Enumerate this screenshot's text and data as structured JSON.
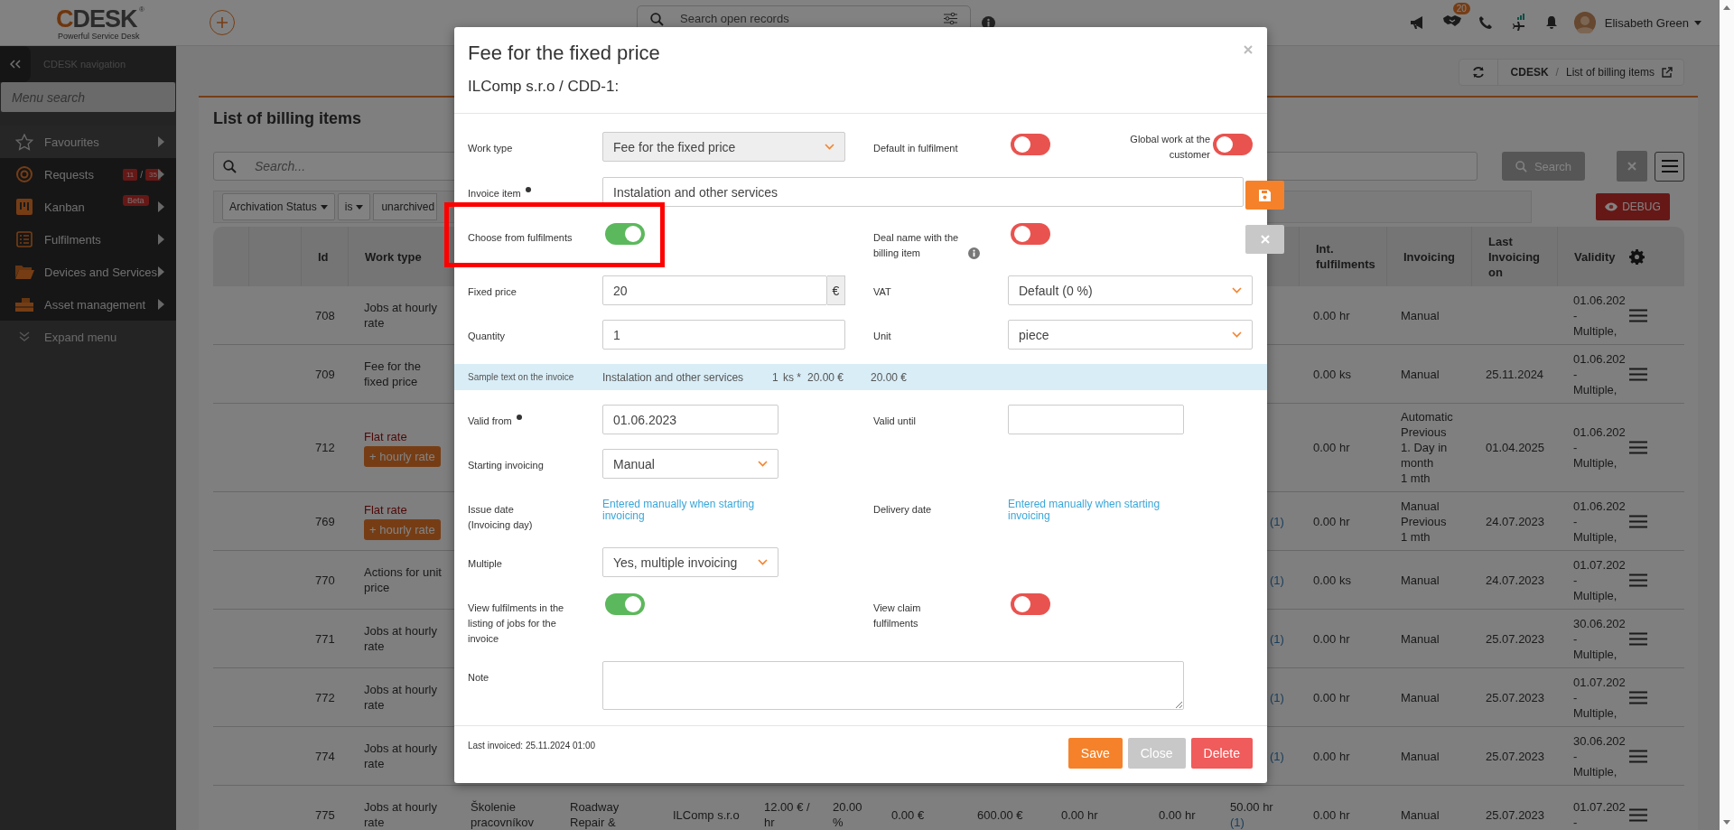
{
  "topbar": {
    "logo": "CDESK",
    "logo_mark": "®",
    "tagline": "Powerful Service Desk",
    "search": {
      "placeholder": "Search open records"
    },
    "handshake_count": "20",
    "user": "Elisabeth Green"
  },
  "sidebar": {
    "title": "CDESK navigation",
    "search": {
      "placeholder": "Menu search"
    },
    "items": [
      {
        "label": "Favourites",
        "selected": true
      },
      {
        "label": "Requests",
        "counts": [
          "11",
          "35"
        ],
        "count_separator": "/",
        "selected": false
      },
      {
        "label": "Kanban",
        "tag": "Beta",
        "selected": false
      },
      {
        "label": "Fulfilments",
        "selected": false
      },
      {
        "label": "Devices and Services",
        "selected": false
      },
      {
        "label": "Asset management",
        "selected": false
      }
    ],
    "expand": "Expand menu"
  },
  "breadcrumb": {
    "items": [
      "CDESK",
      "List of billing items"
    ],
    "separator": "/"
  },
  "page": {
    "title": "List of billing items",
    "search": {
      "placeholder": "Search..."
    },
    "search_button": "Search",
    "debug_button": "DEBUG",
    "filters": [
      {
        "label": "Archivation Status",
        "kind": "dropdown"
      },
      {
        "label": "is",
        "kind": "dropdown"
      },
      {
        "label": "unarchived",
        "kind": "value"
      }
    ]
  },
  "table": {
    "columns": [
      "Id",
      "Work type",
      "Int. fulfilments",
      "Invoicing",
      "Last Invoicing on",
      "Validity"
    ],
    "rows": [
      {
        "id": "708",
        "kind": "plain",
        "work_type": "Jobs at hourly rate",
        "int_fulfilments": "0.00 hr",
        "invoicing": "Manual",
        "validity": "01.06.202\n-\nMultiple,"
      },
      {
        "id": "709",
        "kind": "plain",
        "work_type": "Fee for the fixed price",
        "int_fulfilments": "0.00 ks",
        "invoicing": "Manual",
        "last_invoicing_on": "25.11.2024",
        "validity": "01.06.202\n-\nMultiple,"
      },
      {
        "id": "712",
        "kind": "flat",
        "work_type": "Flat rate",
        "badge": "+ hourly rate",
        "int_fulfilments": "0.00 hr",
        "invoicing": "Automatic\nPrevious\n1. Day in\nmonth\n1 mth",
        "last_invoicing_on": "01.04.2025",
        "validity": "01.06.202\n-\nMultiple,"
      },
      {
        "id": "769",
        "kind": "flat",
        "work_type": "Flat rate",
        "badge": "+ hourly rate",
        "fulfilment_count": "(1)",
        "int_fulfilments": "0.00 hr",
        "invoicing": "Manual\nPrevious\n1 mth",
        "last_invoicing_on": "24.07.2023",
        "validity": "01.06.202\n-\nMultiple,"
      },
      {
        "id": "770",
        "kind": "plain",
        "work_type": "Actions for unit price",
        "fulfilment_count": "(1)",
        "int_fulfilments": "0.00 ks",
        "invoicing": "Manual",
        "last_invoicing_on": "24.07.2023",
        "validity": "01.07.202\n-\nMultiple,"
      },
      {
        "id": "771",
        "kind": "plain",
        "work_type": "Jobs at hourly rate",
        "fulfilment_count": "(1)",
        "int_fulfilments": "0.00 hr",
        "invoicing": "Manual",
        "last_invoicing_on": "25.07.2023",
        "validity": "30.06.202\n-\nMultiple,"
      },
      {
        "id": "772",
        "kind": "plain",
        "work_type": "Jobs at hourly rate",
        "fulfilment_count": "(1)",
        "int_fulfilments": "0.00 hr",
        "invoicing": "Manual",
        "last_invoicing_on": "25.07.2023",
        "validity": "01.07.202\n-\nMultiple,"
      },
      {
        "id": "774",
        "kind": "plain",
        "work_type": "Jobs at hourly rate",
        "fulfilment_count": "(1)",
        "int_fulfilments": "0.00 hr",
        "invoicing": "Manual",
        "last_invoicing_on": "25.07.2023",
        "validity": "30.06.202\n-\nMultiple,"
      },
      {
        "id": "775",
        "kind": "plain",
        "work_type": "Jobs at hourly rate",
        "column_5": "Školenie pracovníkov",
        "column_6": "Roadway Repair &",
        "column_7": "ILComp s.r.o",
        "column_8": "12.00 € / hr",
        "column_9": "20.00 %",
        "column_10": "0.00 €",
        "column_11": "600.00 €",
        "column_12": "0.00 hr",
        "column_13": "0.00 hr",
        "column_14": "50.00 hr",
        "fulfilment_count": "(1)",
        "int_fulfilments": "0.00 hr",
        "invoicing": "Manual",
        "last_invoicing_on": "25.07.2023",
        "validity": "01.07.202\n-"
      }
    ]
  },
  "modal": {
    "title": "Fee for the fixed price",
    "subtitle": "ILComp s.r.o / CDD-1:",
    "rows": [
      {
        "left": {
          "label": "Work type",
          "kind": "select",
          "value": "Fee for the fixed price",
          "disabled": true
        },
        "right": [
          {
            "label": "Default in fulfilment",
            "kind": "toggle",
            "on": false
          },
          {
            "label": "Global work at the customer",
            "kind": "toggle",
            "on": false
          }
        ]
      },
      {
        "left": {
          "label": "Invoice item",
          "required": true,
          "kind": "wide_input",
          "value": "Instalation and other services"
        }
      },
      {
        "left": {
          "label": "Choose from fulfilments",
          "kind": "toggle",
          "on": true
        },
        "right": [
          {
            "label": "Deal name with the billing item",
            "kind": "toggle",
            "on": false,
            "info": true
          }
        ]
      },
      {
        "left": {
          "label": "Fixed price",
          "kind": "money",
          "value": "20",
          "unit": "€"
        },
        "right": [
          {
            "label": "VAT",
            "kind": "select",
            "value": "Default (0 %)"
          }
        ]
      },
      {
        "left": {
          "label": "Quantity",
          "kind": "input",
          "value": "1"
        },
        "right": [
          {
            "label": "Unit",
            "kind": "select",
            "value": "piece"
          }
        ]
      },
      {
        "kind": "sample",
        "label": "Sample text on the invoice",
        "text": "Instalation and other services",
        "quantity": "1",
        "unit": "ks *",
        "price": "20.00 €",
        "total": "20.00 €"
      },
      {
        "left": {
          "label": "Valid from",
          "required": true,
          "kind": "short_input",
          "value": "01.06.2023"
        },
        "right": [
          {
            "label": "Valid until",
            "kind": "short_input"
          }
        ]
      },
      {
        "left": {
          "label": "Starting invoicing",
          "kind": "short_select",
          "value": "Manual"
        }
      },
      {
        "left": {
          "label": "Issue date\n(Invoicing day)",
          "kind": "link",
          "value": "Entered manually when starting invoicing"
        },
        "right": [
          {
            "label": "Delivery date",
            "kind": "link",
            "value": "Entered manually when starting invoicing"
          }
        ]
      },
      {
        "left": {
          "label": "Multiple",
          "kind": "short_select",
          "value": "Yes, multiple invoicing"
        }
      },
      {
        "left": {
          "label": "View fulfilments in the listing of jobs for the invoice",
          "kind": "toggle",
          "on": true
        },
        "right": [
          {
            "label": "View claim fulfilments",
            "kind": "toggle",
            "on": false
          }
        ]
      },
      {
        "left": {
          "label": "Note",
          "kind": "textarea"
        }
      }
    ],
    "footer_note": "Last invoiced: 25.11.2024 01:00",
    "buttons": [
      {
        "label": "Save",
        "kind": "primary"
      },
      {
        "label": "Close",
        "kind": "secondary"
      },
      {
        "label": "Delete",
        "kind": "danger"
      }
    ]
  },
  "side_actions": [
    {
      "kind": "save"
    },
    {
      "kind": "cancel"
    }
  ],
  "annotation": {
    "kind": "frame"
  }
}
